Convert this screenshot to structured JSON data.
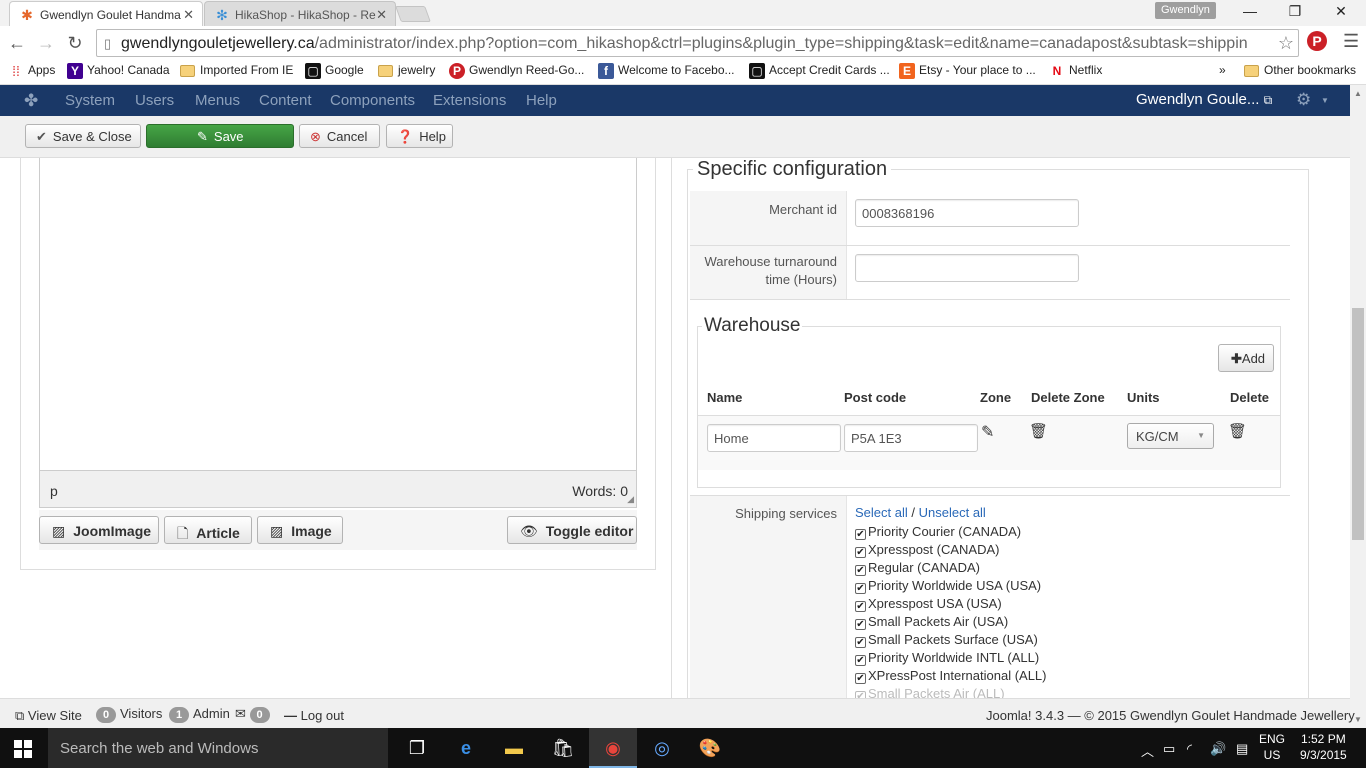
{
  "browser": {
    "tabs": [
      {
        "title": "Gwendlyn Goulet Handma",
        "icon": "joomla-icon"
      },
      {
        "title": "HikaShop - HikaShop - Re",
        "icon": "hikashop-icon"
      }
    ],
    "profile": "Gwendlyn",
    "url_host": "gwendlyngouletjewellery.ca",
    "url_rest": "/administrator/index.php?option=com_hikashop&ctrl=plugins&plugin_type=shipping&task=edit&name=canadapost&subtask=shippin",
    "bookmarks": [
      {
        "label": "Apps",
        "icon": "apps-icon"
      },
      {
        "label": "Yahoo! Canada",
        "icon": "yahoo-icon"
      },
      {
        "label": "Imported From IE",
        "icon": "folder-icon"
      },
      {
        "label": "Google",
        "icon": "square-icon"
      },
      {
        "label": "jewelry",
        "icon": "folder-icon"
      },
      {
        "label": "Gwendlyn Reed-Go...",
        "icon": "pinterest-icon"
      },
      {
        "label": "Welcome to Facebo...",
        "icon": "facebook-icon"
      },
      {
        "label": "Accept Credit Cards ...",
        "icon": "square-icon"
      },
      {
        "label": "Etsy - Your place to ...",
        "icon": "etsy-icon"
      },
      {
        "label": "Netflix",
        "icon": "netflix-icon"
      }
    ],
    "overflow": "»",
    "other_bookmarks": "Other bookmarks"
  },
  "admin_nav": {
    "items": [
      "System",
      "Users",
      "Menus",
      "Content",
      "Components",
      "Extensions",
      "Help"
    ],
    "user": "Gwendlyn Goule..."
  },
  "toolbar": {
    "save_close": "Save & Close",
    "save": "Save",
    "cancel": "Cancel",
    "help": "Help"
  },
  "editor": {
    "path": "p",
    "words": "Words: 0",
    "buttons": [
      "JoomImage",
      "Article",
      "Image",
      "Toggle editor"
    ]
  },
  "config": {
    "legend": "Specific configuration",
    "merchant_label": "Merchant id",
    "merchant_value": "0008368196",
    "turnaround_label_1": "Warehouse turnaround",
    "turnaround_label_2": "time (Hours)",
    "turnaround_value": "",
    "warehouse": {
      "legend": "Warehouse",
      "add": "Add",
      "headers": [
        "Name",
        "Post code",
        "Zone",
        "Delete Zone",
        "Units",
        "Delete"
      ],
      "row": {
        "name": "Home",
        "postcode": "P5A 1E3",
        "units": "KG/CM"
      }
    },
    "services_label": "Shipping services",
    "select_all": "Select all",
    "separator": "/",
    "unselect_all": "Unselect all",
    "services": [
      "Priority Courier (CANADA)",
      "Xpresspost (CANADA)",
      "Regular (CANADA)",
      "Priority Worldwide USA (USA)",
      "Xpresspost USA (USA)",
      "Small Packets Air (USA)",
      "Small Packets Surface (USA)",
      "Priority Worldwide INTL (ALL)",
      "XPressPost International (ALL)",
      "Small Packets Air (ALL)"
    ]
  },
  "statusbar": {
    "view_site": "View Site",
    "visitors_count": "0",
    "visitors": "Visitors",
    "admin_count": "1",
    "admin": "Admin",
    "messages_count": "0",
    "logout": "Log out",
    "footer": "Joomla! 3.4.3 — © 2015 Gwendlyn Goulet Handmade Jewellery"
  },
  "taskbar": {
    "search": "Search the web and Windows",
    "lang_1": "ENG",
    "lang_2": "US",
    "time": "1:52 PM",
    "date": "9/3/2015"
  }
}
